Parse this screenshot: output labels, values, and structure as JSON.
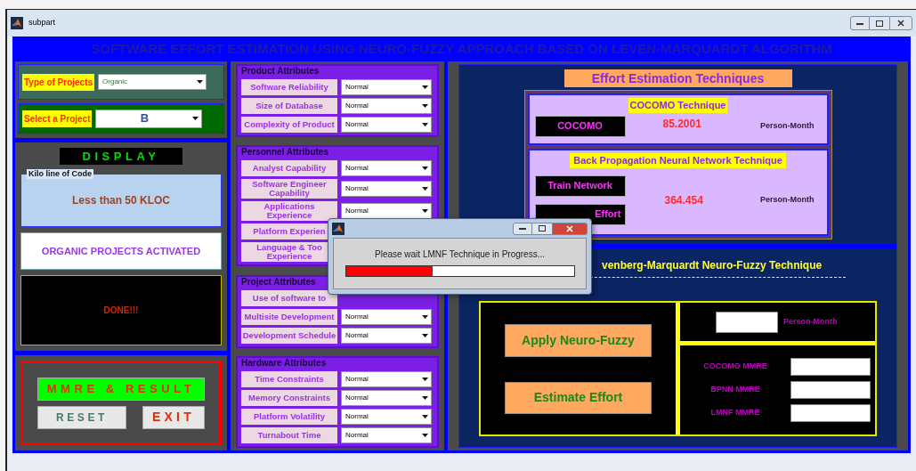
{
  "window": {
    "title": "subpart"
  },
  "banner": "SOFTWARE EFFORT ESTIMATION USING NEURO-FUZZY APPROACH BASED ON LEVEN-MARQUARDT ALGORITHM",
  "project_type": {
    "label": "Type of Projects",
    "value": "Organic"
  },
  "project_select": {
    "label": "Select a Project",
    "value": "B"
  },
  "display": {
    "title": "DISPLAY",
    "kloc_group": "Kilo line of Code",
    "kloc": "Less than 50 KLOC",
    "status": "ORGANIC PROJECTS ACTIVATED",
    "message": "DONE!!!"
  },
  "buttons": {
    "result": "MMRE & RESULT",
    "reset": "RESET",
    "exit": "EXIT"
  },
  "attribute_groups": [
    {
      "title": "Product Attributes",
      "rows": [
        {
          "label": "Software Reliability",
          "value": "Normal"
        },
        {
          "label": "Size of Database",
          "value": "Normal"
        },
        {
          "label": "Complexity of Product",
          "value": "Normal"
        }
      ]
    },
    {
      "title": "Personnel Attributes",
      "rows": [
        {
          "label": "Analyst Capability",
          "value": "Normal"
        },
        {
          "label": "Software Engineer Capability",
          "value": "Normal"
        },
        {
          "label": "Applications Experience",
          "value": "Normal"
        },
        {
          "label": "Platform Experien"
        },
        {
          "label": "Language & Too Experience"
        }
      ]
    },
    {
      "title": "Project Attributes",
      "rows": [
        {
          "label": "Use of software to"
        },
        {
          "label": "Multisite Development",
          "value": "Normal"
        },
        {
          "label": "Development Schedule",
          "value": "Normal"
        }
      ]
    },
    {
      "title": "Hardware Attributes",
      "rows": [
        {
          "label": "Time Constraints",
          "value": "Normal"
        },
        {
          "label": "Memory Constraints",
          "value": "Normal"
        },
        {
          "label": "Platform Volatility",
          "value": "Normal"
        },
        {
          "label": "Turnabout Time",
          "value": "Normal"
        }
      ]
    }
  ],
  "techniques": {
    "title": "Effort Estimation Techniques",
    "cocomo": {
      "heading": "COCOMO Technique",
      "button": "COCOMO",
      "value": "85.2001",
      "unit": "Person-Month"
    },
    "bpnn": {
      "heading": "Back Propagation Neural Network Technique",
      "train_button": "Train Network",
      "estimate_button": "Effort",
      "value": "364.454",
      "unit": "Person-Month"
    }
  },
  "lmnf": {
    "heading": "venberg-Marquardt Neuro-Fuzzy Technique",
    "apply_button": "Apply Neuro-Fuzzy",
    "estimate_button": "Estimate Effort",
    "unit": "Person-Month",
    "mmre": [
      {
        "label": "COCOMO MMRE"
      },
      {
        "label": "BPNN MMRE"
      },
      {
        "label": "LMNF MMRE"
      }
    ]
  },
  "dialog": {
    "message": "Please wait LMNF Technique in Progress...",
    "level": 0.38
  }
}
